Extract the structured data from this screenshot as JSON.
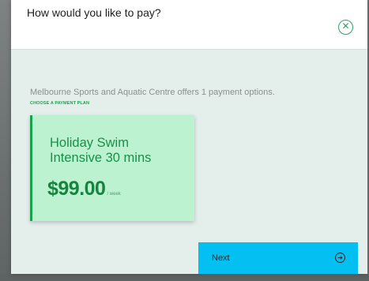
{
  "modal": {
    "title": "How would you like to pay?",
    "close_icon": "circled-x-icon",
    "intro_text": "Melbourne Sports and Aquatic Centre offers 1 payment options.",
    "section_label": "CHOOSE A PAYMENT PLAN",
    "plans": [
      {
        "name": "Holiday Swim Intensive 30 mins",
        "price": "$99.00",
        "period": "/ week"
      }
    ],
    "next_button": {
      "label": "Next",
      "icon": "circled-arrow-right-icon"
    }
  },
  "colors": {
    "accent_green": "#18a24c",
    "card_background": "#bdf2d0",
    "button_blue": "#04bff1",
    "modal_background": "#e4eeeb"
  }
}
